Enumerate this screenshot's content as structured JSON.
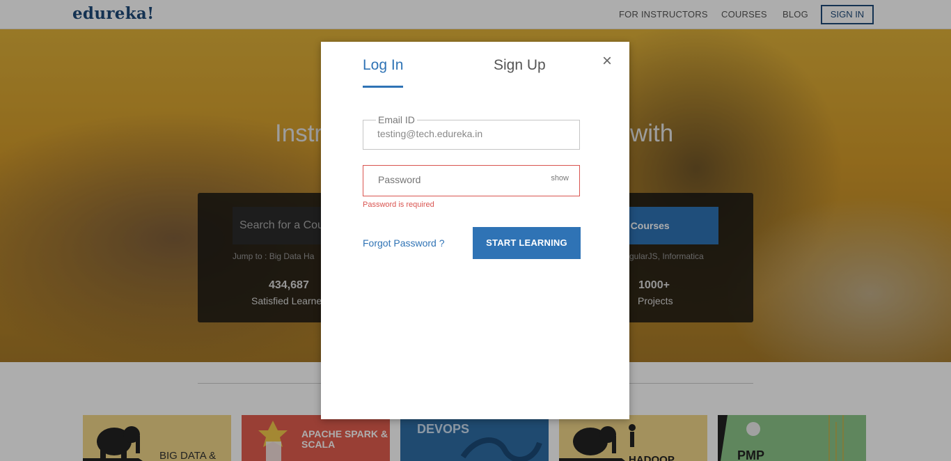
{
  "header": {
    "logo": "edureka!",
    "nav": [
      "FOR INSTRUCTORS",
      "COURSES",
      "BLOG"
    ],
    "sign_in": "SIGN IN"
  },
  "hero": {
    "title_left": "Instr",
    "title_right": "with",
    "search_placeholder": "Search for a Cou",
    "search_button": "e Courses",
    "jump_left": "Jump to : Big Data Ha",
    "jump_right": "gularJS, Informatica",
    "stats": [
      {
        "number": "434,687",
        "label": "Satisfied Learne"
      },
      {
        "number": "1000+",
        "label": "Projects"
      }
    ]
  },
  "cards": [
    {
      "label": "BIG DATA &",
      "bg": "#f0d68a"
    },
    {
      "label": "APACHE SPARK & SCALA",
      "bg": "#e25d4e"
    },
    {
      "label": "DEVOPS",
      "bg": "#2e6ea6"
    },
    {
      "label": "HADOOP",
      "bg": "#f0d68a"
    },
    {
      "label": "PMP",
      "bg": "#8cc689"
    }
  ],
  "modal": {
    "tab_login": "Log In",
    "tab_signup": "Sign Up",
    "close": "×",
    "email_label": "Email ID",
    "email_value": "testing@tech.edureka.in",
    "password_placeholder": "Password",
    "show": "show",
    "error": "Password is required",
    "forgot": "Forgot Password ?",
    "submit": "START LEARNING"
  },
  "colors": {
    "accent": "#2f73b5",
    "error": "#d9534f",
    "brand": "#1e4a7a"
  }
}
